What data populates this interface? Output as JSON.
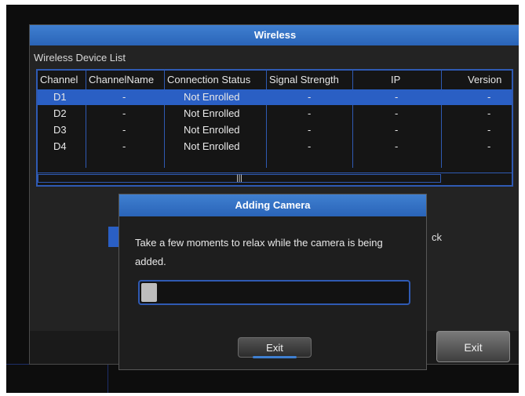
{
  "window": {
    "title": "Wireless",
    "list_title": "Wireless Device List",
    "columns": [
      "Channel",
      "ChannelName",
      "Connection Status",
      "Signal Strength",
      "IP",
      "Version"
    ],
    "rows": [
      {
        "channel": "D1",
        "name": "-",
        "status": "Not Enrolled",
        "signal": "-",
        "ip": "-",
        "version": "-",
        "selected": true
      },
      {
        "channel": "D2",
        "name": "-",
        "status": "Not Enrolled",
        "signal": "-",
        "ip": "-",
        "version": "-",
        "selected": false
      },
      {
        "channel": "D3",
        "name": "-",
        "status": "Not Enrolled",
        "signal": "-",
        "ip": "-",
        "version": "-",
        "selected": false
      },
      {
        "channel": "D4",
        "name": "-",
        "status": "Not Enrolled",
        "signal": "-",
        "ip": "-",
        "version": "-",
        "selected": false
      }
    ],
    "scroll_grip": "|||",
    "partial_button_text": "ck",
    "exit_label": "Exit"
  },
  "dialog": {
    "title": "Adding Camera",
    "message": "Take a few moments to relax while the camera is being added.",
    "progress": 0.06,
    "exit_label": "Exit"
  },
  "colors": {
    "accent": "#2a5fc4",
    "title_bar": "#3f7fd0",
    "background": "#0d0d0d"
  }
}
